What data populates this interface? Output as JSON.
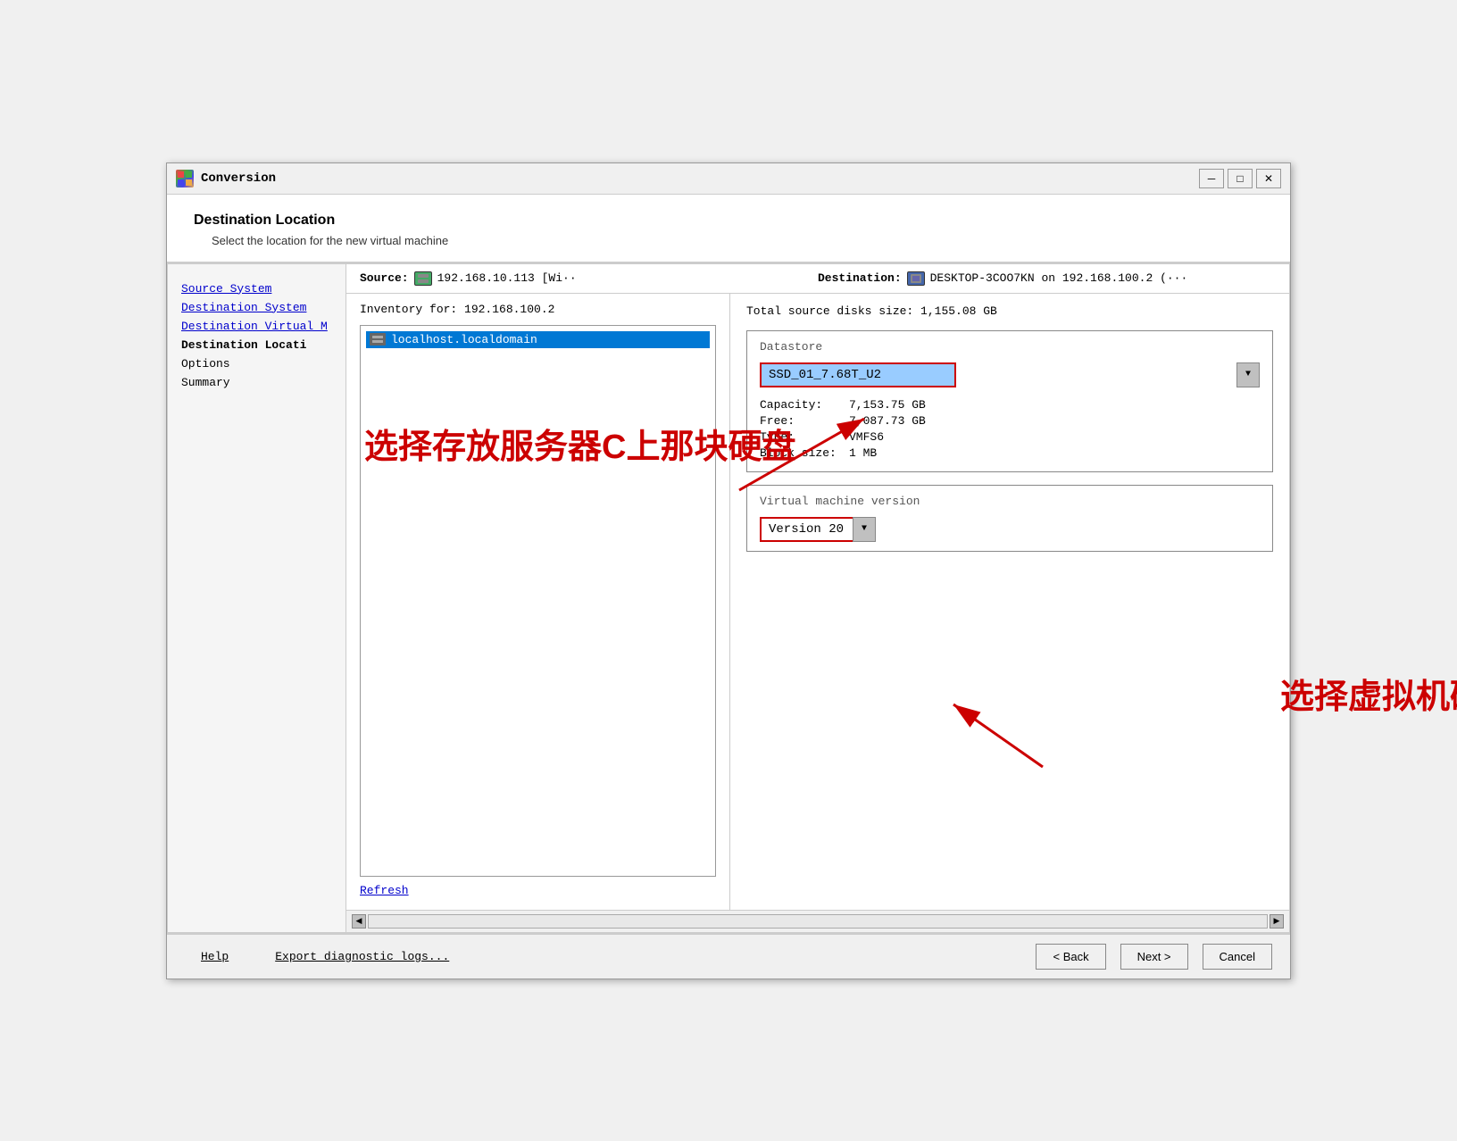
{
  "window": {
    "title": "Conversion",
    "minimize_label": "─",
    "maximize_label": "□",
    "close_label": "✕"
  },
  "header": {
    "title": "Destination Location",
    "subtitle": "Select the location for the new virtual machine"
  },
  "sidebar": {
    "items": [
      {
        "id": "source-system",
        "label": "Source System",
        "type": "link"
      },
      {
        "id": "destination-system",
        "label": "Destination System",
        "type": "link"
      },
      {
        "id": "destination-virtual-m",
        "label": "Destination Virtual M",
        "type": "link"
      },
      {
        "id": "destination-location",
        "label": "Destination Locati",
        "type": "active"
      },
      {
        "id": "options",
        "label": "Options",
        "type": "normal"
      },
      {
        "id": "summary",
        "label": "Summary",
        "type": "normal"
      }
    ]
  },
  "topbar": {
    "source_label": "Source:",
    "source_value": "192.168.10.113 [Wi··",
    "dest_label": "Destination:",
    "dest_value": "DESKTOP-3COO7KN on 192.168.100.2 (···"
  },
  "left_panel": {
    "inventory_label": "Inventory for: 192.168.100.2",
    "tree_item": "localhost.localdomain",
    "refresh_label": "Refresh"
  },
  "right_panel": {
    "total_size_label": "Total source disks size:",
    "total_size_value": "1,155.08 GB",
    "datastore_section": {
      "title": "Datastore",
      "selected": "SSD_01_7.68T_U2",
      "options": [
        "SSD_01_7.68T_U2"
      ],
      "capacity_label": "Capacity:",
      "capacity_value": "7,153.75 GB",
      "free_label": "Free:",
      "free_value": "7,087.73 GB",
      "type_label": "Type:",
      "type_value": "VMFS6",
      "block_size_label": "Block size:",
      "block_size_value": "1 MB"
    },
    "vm_version_section": {
      "title": "Virtual machine version",
      "selected": "Version 20",
      "options": [
        "Version 20"
      ]
    }
  },
  "annotations": {
    "text1": "选择存放服务器C上那块硬盘",
    "text2": "选择虚拟机硬件兼容版本"
  },
  "footer": {
    "help_label": "Help",
    "export_label": "Export diagnostic logs...",
    "back_label": "< Back",
    "next_label": "Next >",
    "cancel_label": "Cancel"
  }
}
